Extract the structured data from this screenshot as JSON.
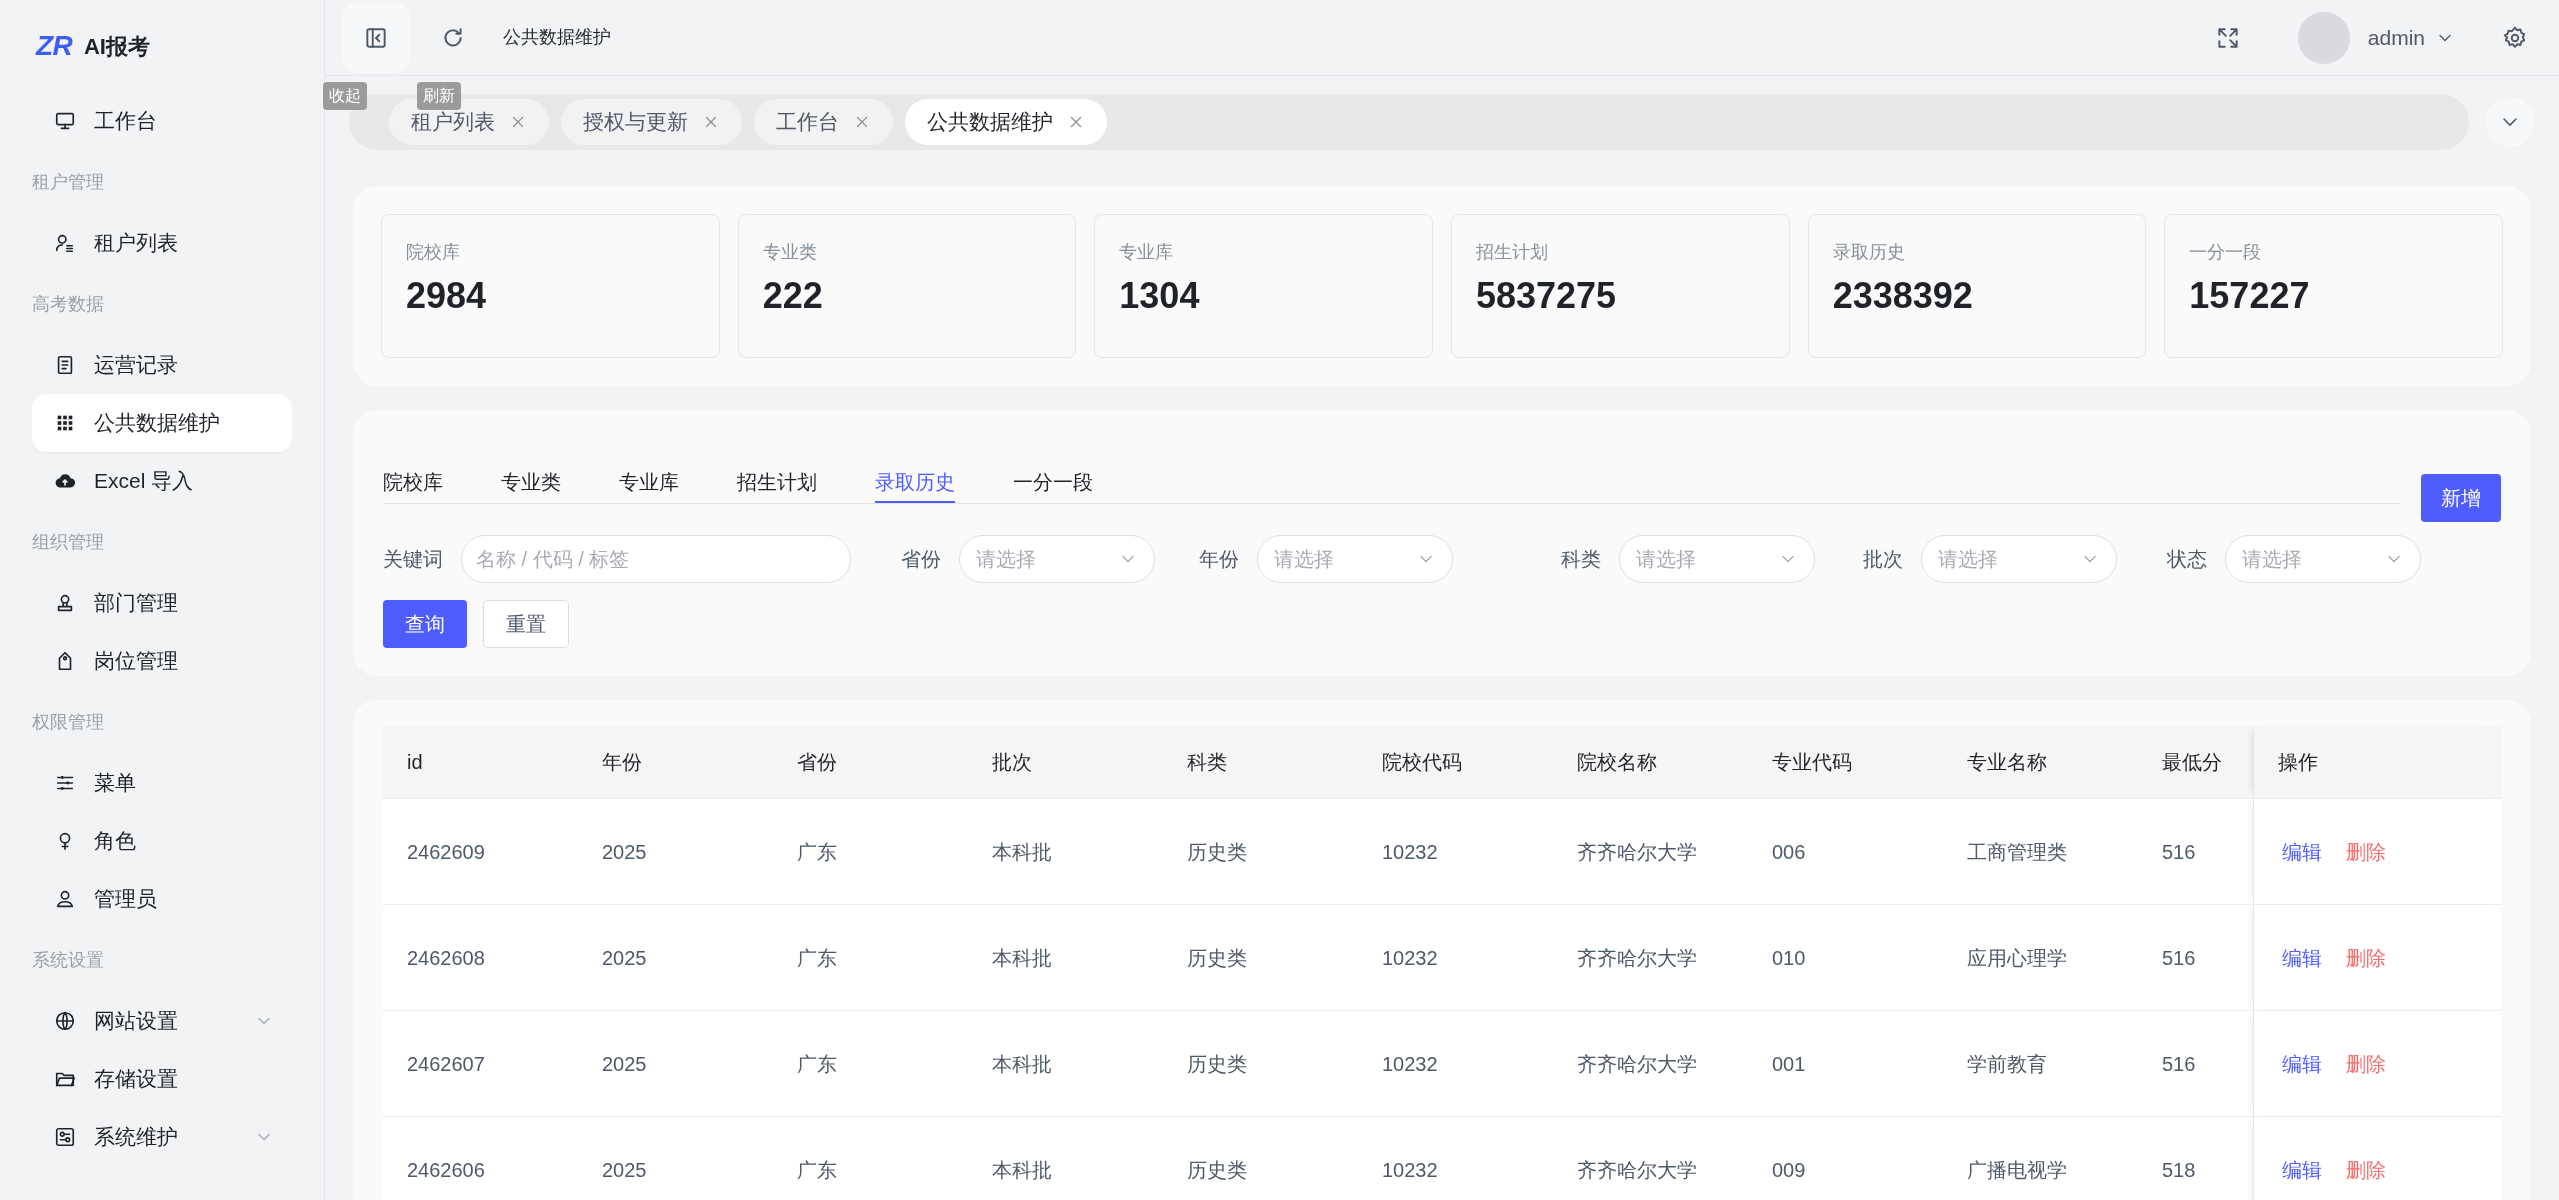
{
  "brand": {
    "logo": "ZR",
    "name": "AI报考"
  },
  "sidebar": {
    "items": [
      {
        "kind": "item",
        "label": "工作台",
        "selected": false
      },
      {
        "kind": "section",
        "label": "租户管理"
      },
      {
        "kind": "item",
        "label": "租户列表",
        "selected": false
      },
      {
        "kind": "section",
        "label": "高考数据"
      },
      {
        "kind": "item",
        "label": "运营记录",
        "selected": false
      },
      {
        "kind": "item",
        "label": "公共数据维护",
        "selected": true
      },
      {
        "kind": "item",
        "label": "Excel 导入",
        "selected": false
      },
      {
        "kind": "section",
        "label": "组织管理"
      },
      {
        "kind": "item",
        "label": "部门管理",
        "selected": false
      },
      {
        "kind": "item",
        "label": "岗位管理",
        "selected": false
      },
      {
        "kind": "section",
        "label": "权限管理"
      },
      {
        "kind": "item",
        "label": "菜单",
        "selected": false
      },
      {
        "kind": "item",
        "label": "角色",
        "selected": false
      },
      {
        "kind": "item",
        "label": "管理员",
        "selected": false
      },
      {
        "kind": "section",
        "label": "系统设置"
      },
      {
        "kind": "item",
        "label": "网站设置",
        "selected": false,
        "expandable": true
      },
      {
        "kind": "item",
        "label": "存储设置",
        "selected": false
      },
      {
        "kind": "item",
        "label": "系统维护",
        "selected": false,
        "expandable": true
      }
    ]
  },
  "header": {
    "breadcrumb": "公共数据维护",
    "user": "admin",
    "tooltips": [
      "收起",
      "刷新"
    ]
  },
  "page_tabs": [
    {
      "label": "租户列表",
      "selected": false
    },
    {
      "label": "授权与更新",
      "selected": false
    },
    {
      "label": "工作台",
      "selected": false
    },
    {
      "label": "公共数据维护",
      "selected": true
    }
  ],
  "stats": [
    {
      "label": "院校库",
      "value": "2984"
    },
    {
      "label": "专业类",
      "value": "222"
    },
    {
      "label": "专业库",
      "value": "1304"
    },
    {
      "label": "招生计划",
      "value": "5837275"
    },
    {
      "label": "录取历史",
      "value": "2338392"
    },
    {
      "label": "一分一段",
      "value": "157227"
    }
  ],
  "data_tabs": [
    {
      "label": "院校库",
      "selected": false
    },
    {
      "label": "专业类",
      "selected": false
    },
    {
      "label": "专业库",
      "selected": false
    },
    {
      "label": "招生计划",
      "selected": false
    },
    {
      "label": "录取历史",
      "selected": true
    },
    {
      "label": "一分一段",
      "selected": false
    }
  ],
  "add_button": "新增",
  "filters": [
    {
      "kind": "text",
      "label": "关键词",
      "placeholder": "名称 / 代码 / 标签"
    },
    {
      "kind": "select",
      "label": "省份",
      "placeholder": "请选择"
    },
    {
      "kind": "select",
      "label": "年份",
      "placeholder": "请选择"
    },
    {
      "kind": "select",
      "label": "科类",
      "placeholder": "请选择"
    },
    {
      "kind": "select",
      "label": "批次",
      "placeholder": "请选择"
    },
    {
      "kind": "select",
      "label": "状态",
      "placeholder": "请选择"
    }
  ],
  "query_button": "查询",
  "reset_button": "重置",
  "table": {
    "columns": [
      "id",
      "年份",
      "省份",
      "批次",
      "科类",
      "院校代码",
      "院校名称",
      "专业代码",
      "专业名称",
      "最低分",
      "操作"
    ],
    "rows": [
      {
        "cells": [
          "2462609",
          "2025",
          "广东",
          "本科批",
          "历史类",
          "10232",
          "齐齐哈尔大学",
          "006",
          "工商管理类",
          "516"
        ],
        "actions": [
          "编辑",
          "删除"
        ]
      },
      {
        "cells": [
          "2462608",
          "2025",
          "广东",
          "本科批",
          "历史类",
          "10232",
          "齐齐哈尔大学",
          "010",
          "应用心理学",
          "516"
        ],
        "actions": [
          "编辑",
          "删除"
        ]
      },
      {
        "cells": [
          "2462607",
          "2025",
          "广东",
          "本科批",
          "历史类",
          "10232",
          "齐齐哈尔大学",
          "001",
          "学前教育",
          "516"
        ],
        "actions": [
          "编辑",
          "删除"
        ]
      },
      {
        "cells": [
          "2462606",
          "2025",
          "广东",
          "本科批",
          "历史类",
          "10232",
          "齐齐哈尔大学",
          "009",
          "广播电视学",
          "518"
        ],
        "actions": [
          "编辑",
          "删除"
        ]
      }
    ]
  }
}
